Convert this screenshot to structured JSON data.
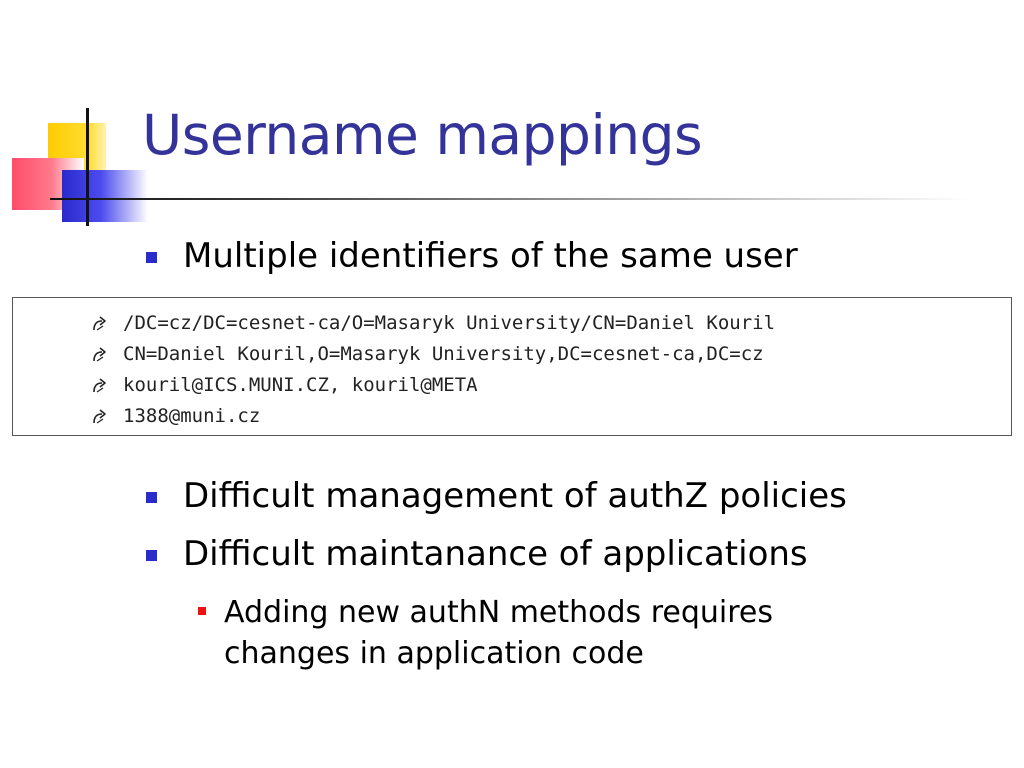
{
  "slide": {
    "title": "Username mappings",
    "bullets": [
      "Multiple identifiers of the same user",
      "Difficult management of authZ policies",
      "Difficult maintanance of applications"
    ],
    "sub_bullet": [
      "Adding new authN methods requires",
      "changes in application code"
    ],
    "identifiers": [
      "/DC=cz/DC=cesnet-ca/O=Masaryk University/CN=Daniel Kouril",
      "CN=Daniel Kouril,O=Masaryk University,DC=cesnet-ca,DC=cz",
      "kouril@ICS.MUNI.CZ, kouril@META",
      "1388@muni.cz"
    ]
  },
  "colors": {
    "title": "#33339a",
    "bullet_marker": "#2b2bcc",
    "sub_bullet_marker": "#ee1111"
  },
  "icons": {
    "identifier_marker": "curved-arrow-icon",
    "bullet_marker": "square-bullet-icon"
  }
}
